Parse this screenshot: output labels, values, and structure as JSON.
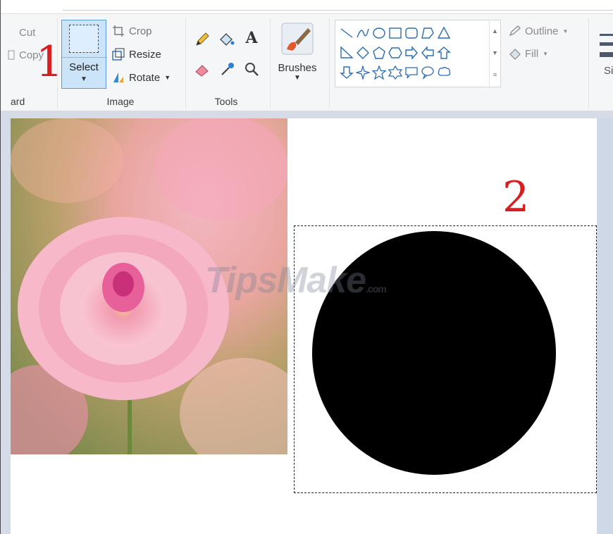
{
  "ribbon": {
    "clipboard": {
      "cut_label": "Cut",
      "copy_label": "Copy",
      "group_label": "ard"
    },
    "image": {
      "select_label": "Select",
      "crop_label": "Crop",
      "resize_label": "Resize",
      "rotate_label": "Rotate",
      "group_label": "Image"
    },
    "tools": {
      "group_label": "Tools",
      "text_tool_glyph": "A"
    },
    "brushes": {
      "label": "Brushes"
    },
    "shapes": {
      "outline_label": "Outline",
      "fill_label": "Fill"
    },
    "size": {
      "label": "Si"
    }
  },
  "canvas": {
    "watermark_text": "TipsMake",
    "watermark_suffix": ".com"
  },
  "annotations": {
    "one": "1",
    "two": "2"
  },
  "colors": {
    "accent": "#cce4f7",
    "annotation": "#d81e1e",
    "shape_fill": "#000000"
  }
}
